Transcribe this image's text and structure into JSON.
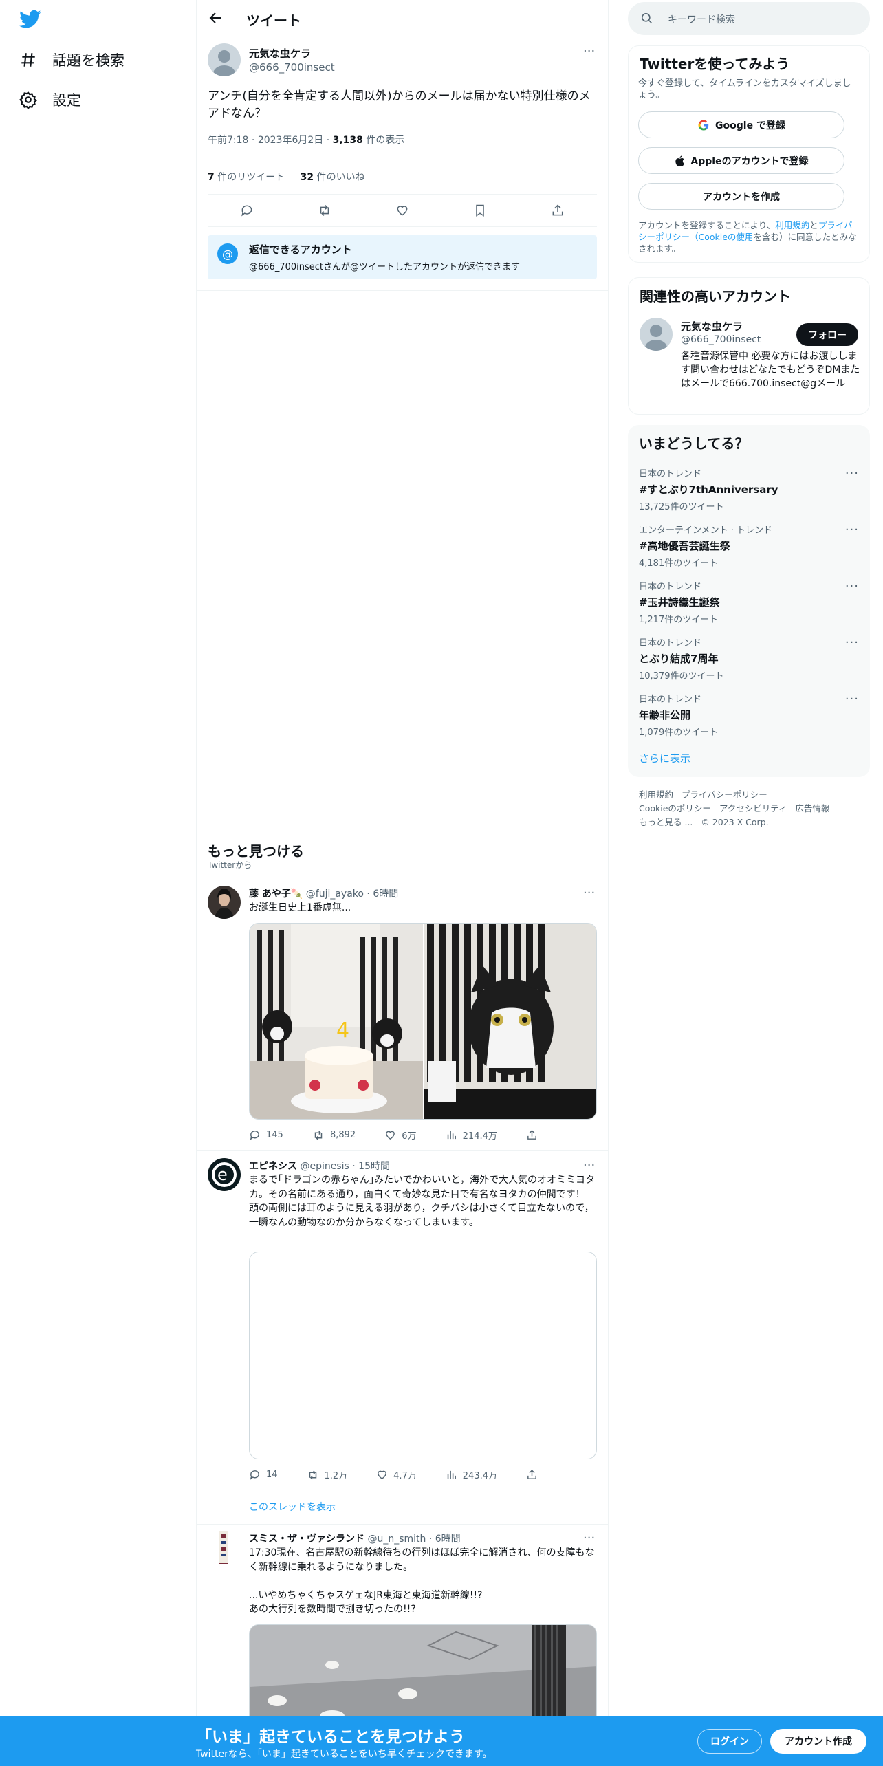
{
  "nav": {
    "explore_label": "話題を検索",
    "settings_label": "設定"
  },
  "header": {
    "title": "ツイート"
  },
  "tweet": {
    "author_name": "元気な虫ケラ",
    "author_handle": "@666_700insect",
    "text": "アンチ(自分を全肯定する人間以外)からのメールは届かない特別仕様のメアドなん？",
    "time": "午前7:18",
    "date": "2023年6月2日",
    "views_count": "3,138",
    "views_label": "件の表示",
    "retweets_count": "7",
    "retweets_label": "件のリツイート",
    "likes_count": "32",
    "likes_label": "件のいいね"
  },
  "reply_notice": {
    "title": "返信できるアカウント",
    "text": "@666_700insectさんが@ツイートしたアカウントが返信できます"
  },
  "discover": {
    "title": "もっと見つける",
    "subtitle": "Twitterから"
  },
  "feed": [
    {
      "name": "藤 あや子🍡",
      "handle": "@fuji_ayako",
      "time": "6時間",
      "text": "お誕生日史上1番虚無...",
      "replies": "145",
      "retweets": "8,892",
      "likes": "6万",
      "views": "214.4万"
    },
    {
      "name": "エピネシス",
      "handle": "@epinesis",
      "time": "15時間",
      "text": "まるで｢ドラゴンの赤ちゃん｣みたいでかわいいと，海外で大人気のオオミミヨタカ。その名前にある通り，面白くて奇妙な見た目で有名なヨタカの仲間です！\n頭の両側には耳のように見える羽があり，クチバシは小さくて目立たないので，一瞬なんの動物なのか分からなくなってしまいます。",
      "replies": "14",
      "retweets": "1.2万",
      "likes": "4.7万",
      "views": "243.4万",
      "thread_link": "このスレッドを表示"
    },
    {
      "name": "スミス・ザ・ヴァシランド",
      "handle": "@u_n_smith",
      "time": "6時間",
      "text": "17:30現在、名古屋駅の新幹線待ちの行列はほぼ完全に解消され、何の支障もなく新幹線に乗れるようになりました。\n\n...いやめちゃくちゃスゲェなJR東海と東海道新幹線!!?\nあの大行列を数時間で捌き切ったの!!?"
    }
  ],
  "search": {
    "placeholder": "キーワード検索"
  },
  "signup": {
    "title": "Twitterを使ってみよう",
    "subtitle": "今すぐ登録して、タイムラインをカスタマイズしましょう。",
    "google_btn": "Google で登録",
    "apple_btn": "Appleのアカウントで登録",
    "create_btn": "アカウントを作成",
    "legal_1": "アカウントを登録することにより、",
    "legal_terms": "利用規約",
    "legal_and": "と",
    "legal_privacy": "プライバシーポリシー（Cookieの使用",
    "legal_2": "を含む）に同意したとみなされます。"
  },
  "relevant": {
    "title": "関連性の高いアカウント",
    "name": "元気な虫ケラ",
    "handle": "@666_700insect",
    "follow_btn": "フォロー",
    "bio": "各種音源保管中 必要な方にはお渡しします問い合わせはどなたでもどうぞDMまたはメールで666.700.insect@gメール"
  },
  "trends": {
    "title": "いまどうしてる？",
    "items": [
      {
        "category": "日本のトレンド",
        "name": "#すとぷり7thAnniversary",
        "count": "13,725件のツイート"
      },
      {
        "category": "エンターテインメント · トレンド",
        "name": "#高地優吾芸誕生祭",
        "count": "4,181件のツイート"
      },
      {
        "category": "日本のトレンド",
        "name": "#玉井詩織生誕祭",
        "count": "1,217件のツイート"
      },
      {
        "category": "日本のトレンド",
        "name": "とぷり結成7周年",
        "count": "10,379件のツイート"
      },
      {
        "category": "日本のトレンド",
        "name": "年齢非公開",
        "count": "1,079件のツイート"
      }
    ],
    "show_more": "さらに表示"
  },
  "footer": {
    "terms": "利用規約",
    "privacy": "プライバシーポリシー",
    "cookie": "Cookieのポリシー",
    "accessibility": "アクセシビリティ",
    "ads": "広告情報",
    "more": "もっと見る ...",
    "copyright": "© 2023 X Corp."
  },
  "bottom_bar": {
    "title": "「いま」起きていることを見つけよう",
    "subtitle": "Twitterなら、「いま」起きていることをいち早くチェックできます。",
    "login_btn": "ログイン",
    "signup_btn": "アカウント作成"
  },
  "colors": {
    "brand": "#1d9bf0",
    "text": "#0f1419",
    "muted": "#536471"
  }
}
